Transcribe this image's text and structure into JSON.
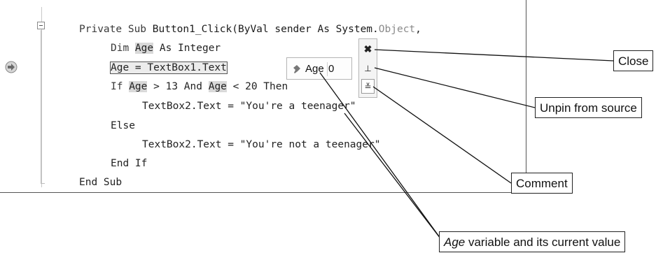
{
  "code": {
    "line1": {
      "kw1": "Private Sub ",
      "name": "Button1_Click(ByVal sender As System.",
      "type": "Object",
      "tail": ","
    },
    "line2": {
      "kw": "Dim ",
      "var": "Age",
      "rest": " As Integer"
    },
    "line3": {
      "stmt": "Age = TextBox1.Text"
    },
    "line4": {
      "kw": "If ",
      "var1": "Age",
      "mid": " > 13 And ",
      "var2": "Age",
      "rest": " < 20 Then"
    },
    "line5": {
      "text": "TextBox2.Text = \"You're a teenager\""
    },
    "line6": {
      "text": "Else"
    },
    "line7": {
      "text": "TextBox2.Text = \"You're not a teenager\""
    },
    "line8": {
      "text": "End If"
    },
    "line9": {
      "text": "End Sub"
    }
  },
  "datatip": {
    "name": "Age",
    "value": "0"
  },
  "tip_tools": {
    "close_glyph": "✖",
    "pin_glyph": "⊥",
    "expand_glyph": "≚"
  },
  "callouts": {
    "close": "Close",
    "unpin": "Unpin from source",
    "comment": "Comment",
    "age_italic": "Age",
    "age_rest": " variable and its current value"
  },
  "colors": {
    "highlight": "#d9d9d9",
    "border": "#555555"
  }
}
